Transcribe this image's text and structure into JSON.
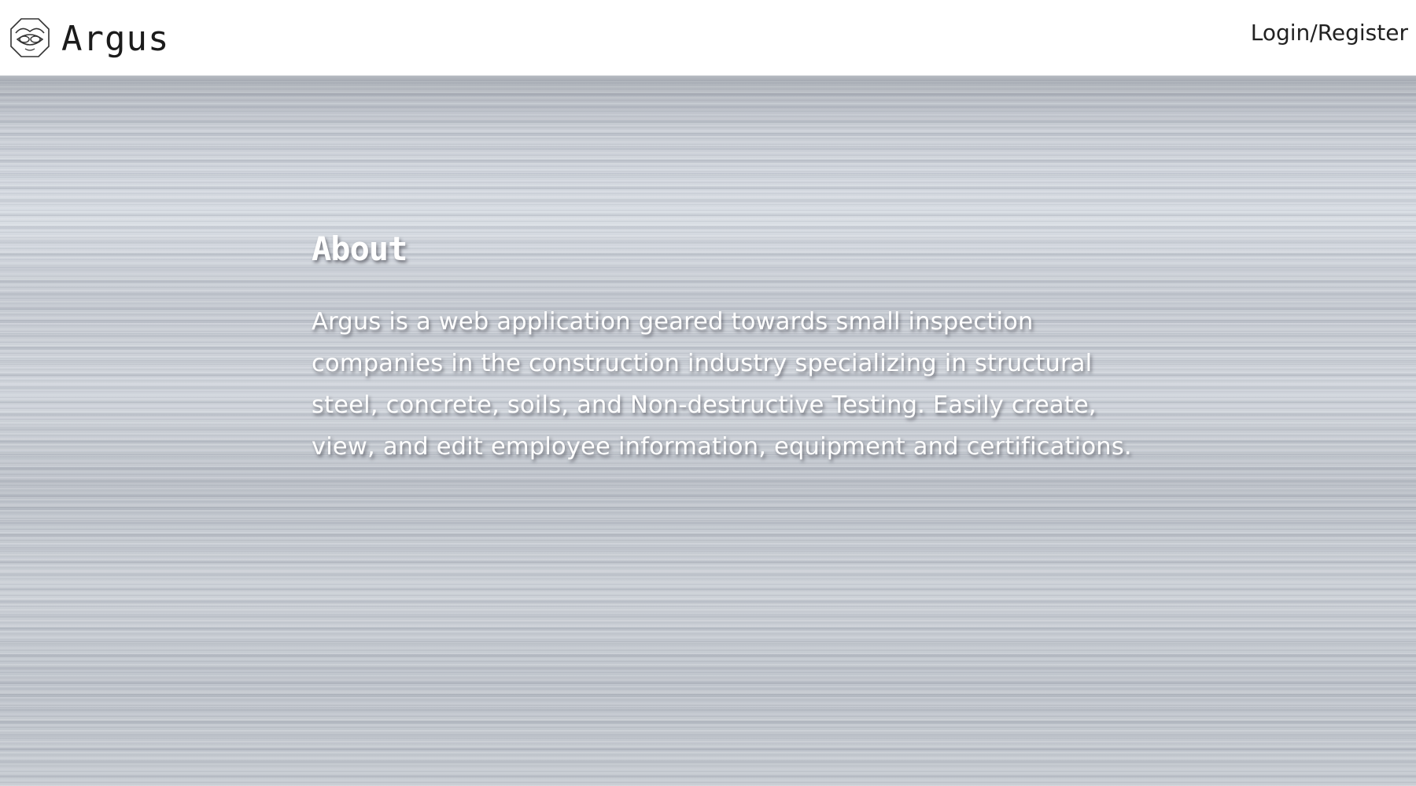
{
  "header": {
    "brand_name": "Argus",
    "login_label": "Login/Register"
  },
  "about": {
    "title": "About",
    "text": "Argus is a web application geared towards small inspection companies in the construction industry specializing in structural steel, concrete, soils, and Non-destructive Testing. Easily create, view, and edit employee information, equipment and certifications."
  },
  "icons": {
    "logo": "argus-logo-icon"
  },
  "colors": {
    "header_bg": "#ffffff",
    "hero_bg": "#c3c8d0",
    "hero_text": "#ffffff"
  }
}
